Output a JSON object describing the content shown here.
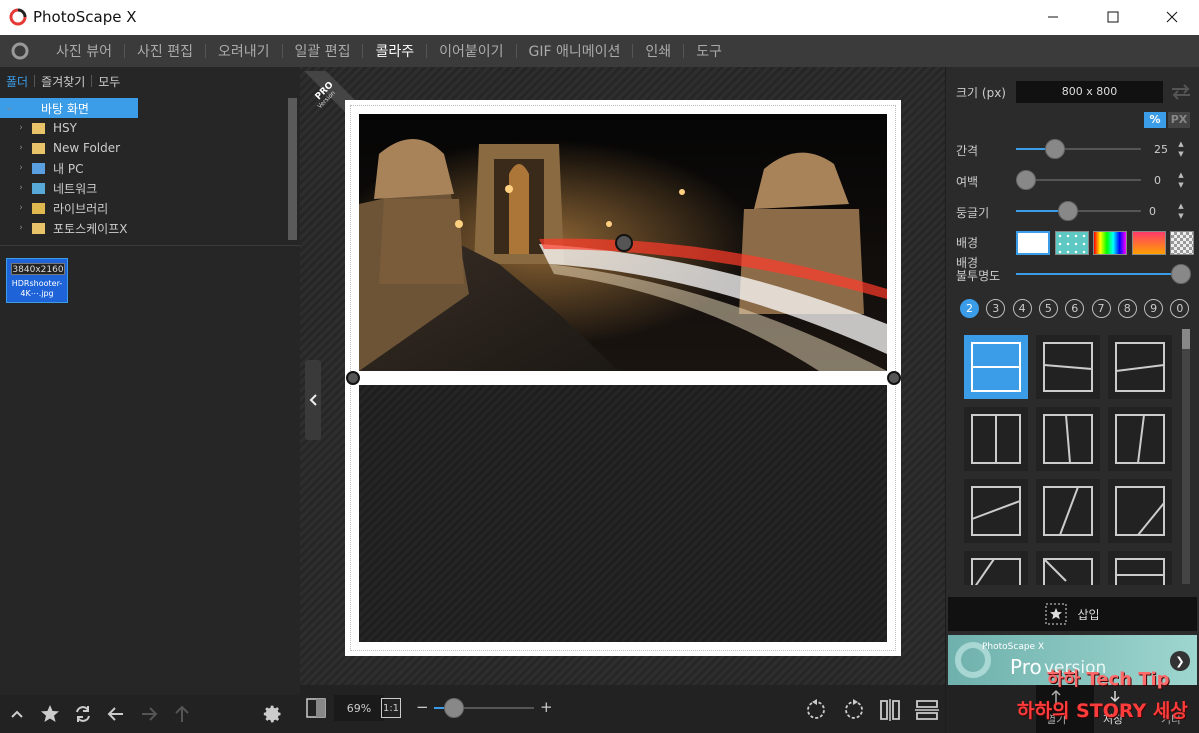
{
  "app": {
    "title": "PhotoScape X"
  },
  "menu": {
    "items": [
      "사진 뷰어",
      "사진 편집",
      "오려내기",
      "일괄 편집",
      "콜라주",
      "이어붙이기",
      "GIF 애니메이션",
      "인쇄",
      "도구"
    ],
    "active_index": 4
  },
  "left_panel": {
    "tabs": [
      "폴더",
      "즐겨찾기",
      "모두"
    ],
    "active_tab": 0,
    "tree": [
      {
        "label": "바탕 화면",
        "icon": "desktop-icon",
        "selected": true
      },
      {
        "label": "HSY",
        "icon": "user-folder-icon"
      },
      {
        "label": "New Folder",
        "icon": "folder-icon"
      },
      {
        "label": "내 PC",
        "icon": "pc-icon"
      },
      {
        "label": "네트워크",
        "icon": "network-icon"
      },
      {
        "label": "라이브러리",
        "icon": "library-icon"
      },
      {
        "label": "포토스케이프X",
        "icon": "folder-icon"
      }
    ],
    "thumbnail": {
      "resolution": "3840x2160",
      "name": "HDRshooter-4K⋯.jpg"
    }
  },
  "center": {
    "pro_badge": {
      "line1": "PRO",
      "line2": "Version"
    },
    "zoom": {
      "percent": "69%",
      "one_to_one": "1:1",
      "minus": "−",
      "plus": "+",
      "level": 0.12
    }
  },
  "right_panel": {
    "size": {
      "label": "크기 (px)",
      "value": "800 x 800"
    },
    "units": {
      "percent": "%",
      "px": "PX",
      "active": "percent"
    },
    "spacing": {
      "label": "간격",
      "value": "25",
      "fraction": 0.28
    },
    "margin": {
      "label": "여백",
      "value": "0",
      "fraction": 0.0
    },
    "round": {
      "label": "둥글기",
      "value": "0",
      "fraction": 0.4
    },
    "background": {
      "label": "배경",
      "swatches": [
        "#ffffff",
        "#5ec8c2",
        "rainbow",
        "#ff5a3c",
        "checker"
      ]
    },
    "bg_opacity": {
      "label_line1": "배경",
      "label_line2": "불투명도",
      "fraction": 1.0
    },
    "counts": [
      "2",
      "3",
      "4",
      "5",
      "6",
      "7",
      "8",
      "9",
      "0"
    ],
    "active_count": "2",
    "insert_label": "삽입",
    "pro_ad": {
      "small": "PhotoScape X",
      "pro": "Pro",
      "version": "version"
    },
    "bottom": {
      "share": "열기",
      "save": "저장",
      "more": "기타"
    }
  },
  "watermark": {
    "line1": "하하 Tech Tip",
    "line2": "하하의 STORY 세상"
  },
  "colors": {
    "accent": "#3b9ce8",
    "panel": "#262626",
    "canvas": "#ffffff"
  }
}
